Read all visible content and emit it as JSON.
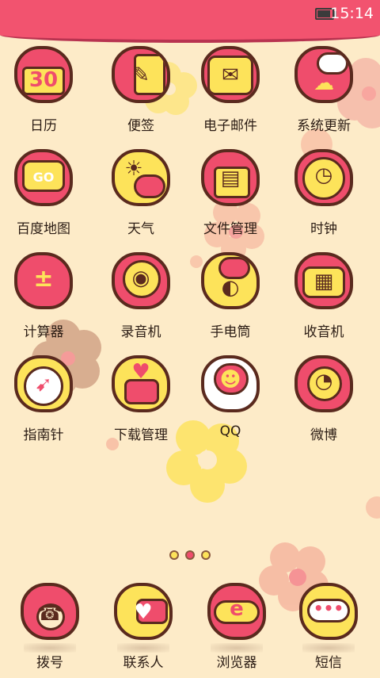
{
  "status_bar": {
    "time": "15:14",
    "battery_icon": "battery-icon"
  },
  "apps": [
    {
      "label": "日历",
      "icon": "calendar-icon",
      "glyph": "30"
    },
    {
      "label": "便签",
      "icon": "notes-icon",
      "glyph": "✎"
    },
    {
      "label": "电子邮件",
      "icon": "mail-icon",
      "glyph": "✉"
    },
    {
      "label": "系统更新",
      "icon": "update-icon",
      "glyph": "☁"
    },
    {
      "label": "百度地图",
      "icon": "map-icon",
      "glyph": "GO"
    },
    {
      "label": "天气",
      "icon": "weather-icon",
      "glyph": "☀"
    },
    {
      "label": "文件管理",
      "icon": "folder-icon",
      "glyph": "▤"
    },
    {
      "label": "时钟",
      "icon": "clock-icon",
      "glyph": "◷"
    },
    {
      "label": "计算器",
      "icon": "calculator-icon",
      "glyph": "±"
    },
    {
      "label": "录音机",
      "icon": "recorder-icon",
      "glyph": "◉"
    },
    {
      "label": "手电筒",
      "icon": "flashlight-icon",
      "glyph": "◐"
    },
    {
      "label": "收音机",
      "icon": "radio-icon",
      "glyph": "▦"
    },
    {
      "label": "指南针",
      "icon": "compass-icon",
      "glyph": "➹"
    },
    {
      "label": "下载管理",
      "icon": "download-icon",
      "glyph": "♥"
    },
    {
      "label": "QQ",
      "icon": "qq-penguin-icon",
      "glyph": "☻"
    },
    {
      "label": "微博",
      "icon": "weibo-icon",
      "glyph": "◔"
    }
  ],
  "page_indicator": {
    "pages": 3,
    "active": 2
  },
  "dock": [
    {
      "label": "拨号",
      "icon": "phone-icon",
      "glyph": "☎"
    },
    {
      "label": "联系人",
      "icon": "contacts-icon",
      "glyph": "♥"
    },
    {
      "label": "浏览器",
      "icon": "browser-icon",
      "glyph": "e"
    },
    {
      "label": "短信",
      "icon": "message-icon",
      "glyph": "•••"
    }
  ],
  "colors": {
    "background": "#fdebc8",
    "accent": "#ef4d6c",
    "yellow": "#fde35a",
    "outline": "#5a2a1e"
  }
}
